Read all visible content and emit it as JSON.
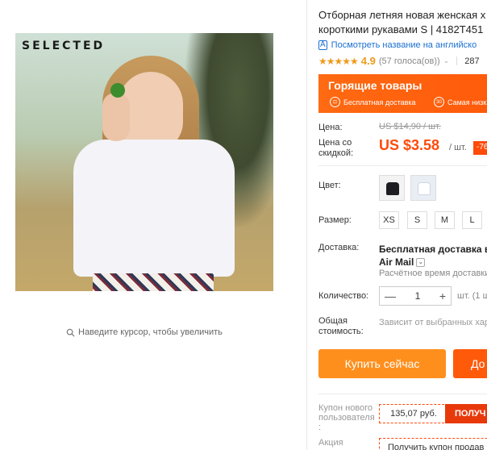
{
  "gallery": {
    "brand": "SELECTED",
    "zoom_hint": "Наведите курсор, чтобы увеличить",
    "zoom_icon": "magnifier-icon"
  },
  "product": {
    "title_line1": "Отборная летняя новая женская х",
    "title_line2": "короткими рукавами S | 4182T451",
    "translate_ai": "A",
    "translate_link": "Посмотреть название на английско",
    "rating_score": "4.9",
    "rating_stars": "★★★★★",
    "rating_votes": "(57 голоса(ов))",
    "orders": "287"
  },
  "hot_deals": {
    "title": "Горящие товары",
    "free_shipping_badge": "⊡",
    "free_shipping": "Бесплатная доставка",
    "cheapest_badge": "30",
    "cheapest": "Самая низк"
  },
  "price": {
    "label": "Цена:",
    "old": "US $14,90 / шт.",
    "discount_label_1": "Цена со",
    "discount_label_2": "скидкой:",
    "new": "US $3.58",
    "unit": "/ шт.",
    "discount": "-76"
  },
  "color": {
    "label": "Цвет:",
    "options": [
      "black",
      "white"
    ],
    "selected": "white"
  },
  "size": {
    "label": "Размер:",
    "options": [
      "XS",
      "S",
      "M",
      "L"
    ]
  },
  "shipping": {
    "label": "Доставка:",
    "method_line1": "Бесплатная доставка в R",
    "method_line2": "Air Mail",
    "time": "Расчётное время доставки"
  },
  "quantity": {
    "label": "Количество:",
    "value": "1",
    "minus": "—",
    "plus": "+",
    "unit": "шт. (1 ш"
  },
  "total": {
    "label_1": "Общая",
    "label_2": "стоимость:",
    "value": "Зависит от выбранных хар"
  },
  "actions": {
    "buy_now": "Купить сейчас",
    "add_to_cart": "До"
  },
  "coupons": {
    "new_user_label_1": "Купон нового",
    "new_user_label_2": "пользователя",
    "new_user_label_3": ":",
    "new_user_value": "135,07 руб.",
    "new_user_action": "ПОЛУЧ",
    "shares_label_1": "Акция",
    "shares_value": "Получить купон продав"
  },
  "colors": {
    "accent": "#ff4b0a",
    "buy_button": "#ff8f1c",
    "hot_banner": "#ff6a12",
    "link": "#1a6fd1",
    "star": "#f09a1a"
  }
}
